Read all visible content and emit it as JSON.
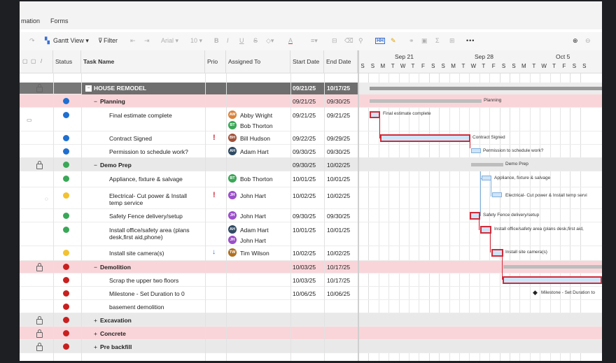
{
  "menu": {
    "item1": "mation",
    "item2": "Forms"
  },
  "toolbar": {
    "gantt_view": "Gantt View",
    "filter": "Filter",
    "font": "Arial",
    "size": "10",
    "bold": "B",
    "italic": "I",
    "underline": "U",
    "strike": "S",
    "text_color": "A",
    "more": "•••"
  },
  "columns": {
    "status": "Status",
    "task_name": "Task Name",
    "prio": "Prio",
    "assigned_to": "Assigned To",
    "start_date": "Start Date",
    "end_date": "End Date"
  },
  "timeline": {
    "weeks": [
      "Sep 21",
      "Sep 28",
      "Oct 5"
    ],
    "days": [
      "S",
      "S",
      "M",
      "T",
      "W",
      "T",
      "F",
      "S",
      "S",
      "M",
      "T",
      "W",
      "T",
      "F",
      "S",
      "S",
      "M",
      "T",
      "W",
      "T",
      "F",
      "S",
      "S"
    ]
  },
  "rows": [
    {
      "name": "HOUSE REMODEL",
      "start": "09/21/25",
      "end": "10/17/25"
    },
    {
      "name": "Planning",
      "start": "09/21/25",
      "end": "09/30/25",
      "gantt_label": "Planning"
    },
    {
      "name": "Final estimate complete",
      "assignee1": "Abby Wright",
      "assignee2": "Bob Thorton",
      "start": "09/21/25",
      "end": "09/21/25",
      "gantt_label": "Final estimate complete"
    },
    {
      "name": "Contract Signed",
      "prio": "!",
      "assignee1": "Bill Hudson",
      "start": "09/22/25",
      "end": "09/29/25",
      "gantt_label": "Contract Signed"
    },
    {
      "name": "Permission to schedule work?",
      "assignee1": "Adam Hart",
      "start": "09/30/25",
      "end": "09/30/25",
      "gantt_label": "Permission to schedule work?"
    },
    {
      "name": "Demo Prep",
      "start": "09/30/25",
      "end": "10/02/25",
      "gantt_label": "Demo Prep"
    },
    {
      "name": "Appliance, fixture & salvage",
      "assignee1": "Bob Thorton",
      "start": "10/01/25",
      "end": "10/01/25",
      "gantt_label": "Appliance, fixture & salvage"
    },
    {
      "name1": "Electrical- Cut power & Install",
      "name2": "temp service",
      "prio": "!",
      "assignee1": "John Hart",
      "start": "10/02/25",
      "end": "10/02/25",
      "gantt_label": "Electrical- Cut power & Install temp servi"
    },
    {
      "name": "Safety Fence delivery/setup",
      "assignee1": "John Hart",
      "start": "09/30/25",
      "end": "09/30/25",
      "gantt_label": "Safety Fence delivery/setup"
    },
    {
      "name1": "Install office/safety area (plans",
      "name2": "desk,first aid,phone)",
      "assignee1": "Adam Hart",
      "assignee2": "John Hart",
      "start": "10/01/25",
      "end": "10/01/25",
      "gantt_label": "Install office/safety area (plans desk,first aid,"
    },
    {
      "name": "Install site camera(s)",
      "prio": "↓",
      "assignee1": "Tim Wilson",
      "start": "10/02/25",
      "end": "10/02/25",
      "gantt_label": "Install site camera(s)"
    },
    {
      "name": "Demolition",
      "start": "10/03/25",
      "end": "10/17/25"
    },
    {
      "name": "Scrap the upper two floors",
      "start": "10/03/25",
      "end": "10/17/25"
    },
    {
      "name": "Milestone - Set Duration to 0",
      "start": "10/06/25",
      "end": "10/06/25",
      "gantt_label": "Milestone - Set Duration to"
    },
    {
      "name": "basement demolition"
    },
    {
      "name": "Excavation"
    },
    {
      "name": "Concrete"
    },
    {
      "name": "Pre backfill"
    }
  ],
  "avatars": {
    "AW": "AW",
    "BT": "BT",
    "BH": "BH",
    "AH": "AH",
    "JH": "JH",
    "TW": "TW"
  },
  "colors": {
    "blue": "#1f6fd1",
    "green": "#3aa757",
    "yellow": "#f2c230",
    "red": "#c8201f",
    "accent_red": "#d12b3a",
    "pink_row": "#f9d5d9"
  }
}
